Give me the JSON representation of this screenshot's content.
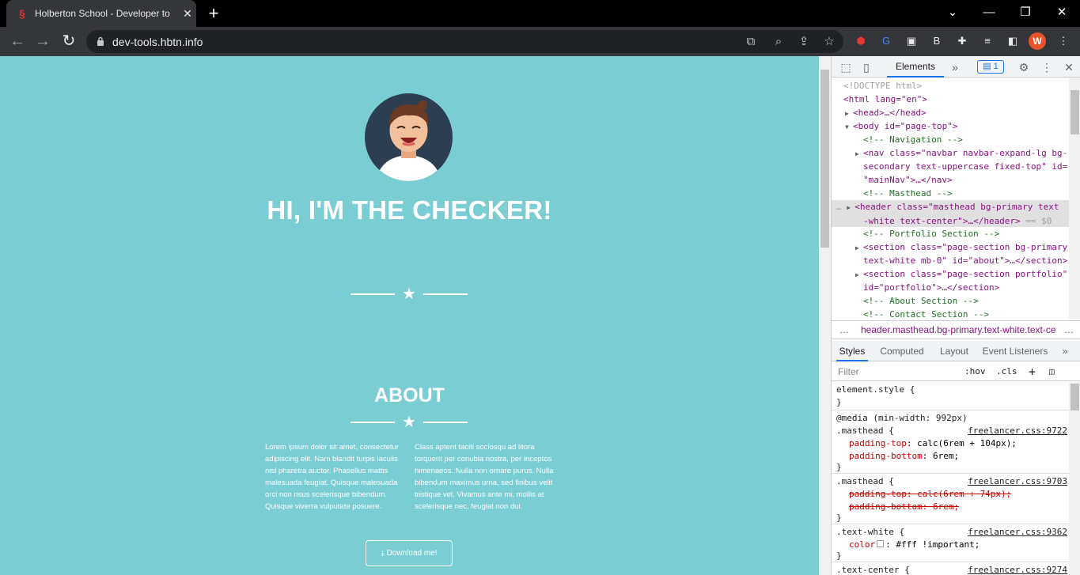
{
  "browser": {
    "tab_title": "Holberton School - Developer to",
    "url": "dev-tools.hbtn.info",
    "profile_initial": "W"
  },
  "page": {
    "hero_title": "HI, I'M THE CHECKER!",
    "about_title": "ABOUT",
    "about_col1": "Lorem ipsum dolor sit amet, consectetur adipiscing elit. Nam blandit turpis iaculis nisl pharetra auctor. Phasellus mattis malesuada feugiat. Quisque malesuada orci non risus scelerisque bibendum. Quisque viverra vulputate posuere.",
    "about_col2": "Class aptent taciti sociosqu ad litora torquent per conubia nostra, per inceptos himenaeos. Nulla non ornare purus. Nulla bibendum maximus urna, sed finibus velit tristique vel. Vivamus ante mi, mollis at scelerisque nec, feugiat non dui.",
    "download_label": "Download me!",
    "colors": {
      "background": "#79cdd3",
      "text": "#ffffff"
    }
  },
  "devtools": {
    "main_tab": "Elements",
    "issues_count": "1",
    "dom": {
      "doctype": "<!DOCTYPE html>",
      "html_open": "<html lang=\"en\">",
      "head": "<head>…</head>",
      "body_open": "<body id=\"page-top\">",
      "c_nav": "<!-- Navigation -->",
      "nav_1": "<nav class=\"navbar navbar-expand-lg bg-",
      "nav_2": "secondary text-uppercase fixed-top\" id=",
      "nav_3": "\"mainNav\">…</nav>",
      "c_masthead": "<!-- Masthead -->",
      "header_1": "<header class=\"masthead bg-primary text",
      "header_2": "-white text-center\">…</header>",
      "header_marker": "== $0",
      "c_portfolio": "<!-- Portfolio Section -->",
      "section1_1": "<section class=\"page-section bg-primary",
      "section1_2": "text-white mb-0\" id=\"about\">…</section>",
      "section2_1": "<section class=\"page-section portfolio\"",
      "section2_2": "id=\"portfolio\">…</section>",
      "c_about": "<!-- About Section -->",
      "c_contact": "<!-- Contact Section -->"
    },
    "breadcrumb": "header.masthead.bg-primary.text-white.text-ce",
    "sub_tabs": [
      "Styles",
      "Computed",
      "Layout",
      "Event Listeners"
    ],
    "filter_placeholder": "Filter",
    "hov": ":hov",
    "cls": ".cls",
    "styles": {
      "element_style": "element.style {",
      "close": "}",
      "media": "@media (min-width: 992px)",
      "r1_sel": ".masthead {",
      "r1_src": "freelancer.css:9722",
      "r1_d1_prop": "padding-top",
      "r1_d1_val": ": calc(6rem + 104px);",
      "r1_d2_prop": "padding-bottom",
      "r1_d2_val": ": 6rem;",
      "r2_sel": ".masthead {",
      "r2_src": "freelancer.css:9703",
      "r2_d1": "padding-top: calc(6rem + 74px);",
      "r2_d2": "padding-bottom: 6rem;",
      "r3_sel": ".text-white {",
      "r3_src": "freelancer.css:9362",
      "r3_d1_prop": "color",
      "r3_d1_val": ": #fff !important;",
      "r4_sel": ".text-center {",
      "r4_src": "freelancer.css:9274"
    }
  }
}
